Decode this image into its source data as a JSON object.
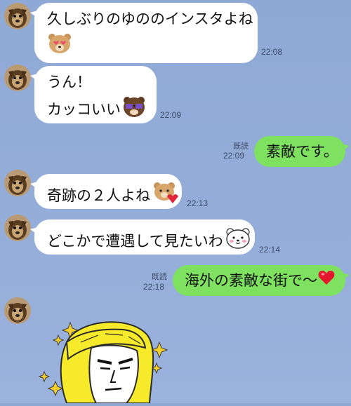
{
  "messages": [
    {
      "sender": "friend",
      "lines": [
        "久しぶりのゆののインスタよね"
      ],
      "time": "22:08",
      "sticker_icon": "bear-heart-eyes-icon"
    },
    {
      "sender": "friend",
      "lines": [
        "うん！",
        "カッコいい"
      ],
      "time": "22:09",
      "sticker_icon": "brown-bear-sunglasses-icon"
    },
    {
      "sender": "me",
      "text": "素敵です。",
      "time": "22:09",
      "read_label": "既読"
    },
    {
      "sender": "friend",
      "text": "奇跡の２人よね",
      "time": "22:13",
      "sticker_icon": "bear-heart-icon"
    },
    {
      "sender": "friend",
      "text": "どこかで遭遇して見たいわ",
      "time": "22:14",
      "sticker_icon": "white-bear-icon"
    },
    {
      "sender": "me",
      "text": "海外の素敵な街で〜",
      "time": "22:18",
      "read_label": "既読",
      "emoji_icon": "red-heart-icon"
    },
    {
      "sender": "friend",
      "type": "sticker",
      "sticker_icon": "blonde-man-sticker-icon"
    }
  ],
  "colors": {
    "background": "#93acd8",
    "incoming_bubble": "#ffffff",
    "outgoing_bubble": "#7ee15f",
    "meta_text": "#3e4a66"
  }
}
